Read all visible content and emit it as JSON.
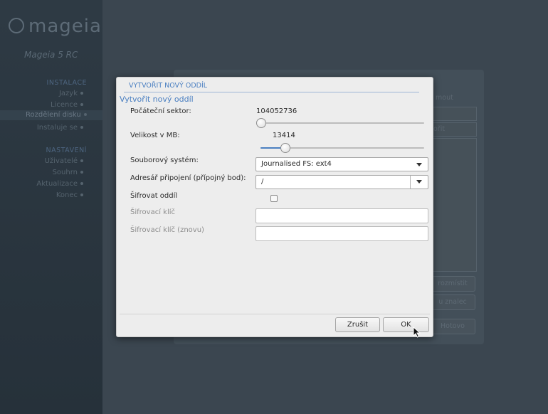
{
  "sidebar": {
    "logo_text": "mageia",
    "version": "Mageia 5 RC",
    "sections": [
      {
        "heading": "INSTALACE",
        "items": [
          {
            "label": "Jazyk",
            "active": false
          },
          {
            "label": "Licence",
            "active": false
          },
          {
            "label": "Rozdělení disku",
            "active": true
          },
          {
            "label": "Instaluje se",
            "active": false
          }
        ]
      },
      {
        "heading": "NASTAVENÍ",
        "items": [
          {
            "label": "Uživatelé",
            "active": false
          },
          {
            "label": "Souhrn",
            "active": false
          },
          {
            "label": "Aktualizace",
            "active": false
          },
          {
            "label": "Konec",
            "active": false
          }
        ]
      }
    ]
  },
  "background_panel": {
    "partial_labels": [
      "mout",
      "ořit"
    ],
    "buttons": [
      "rozmístit",
      "u znalec",
      "Hotovo"
    ]
  },
  "dialog": {
    "title": "VYTVOŘIT NOVÝ ODDÍL",
    "subtitle": "Vytvořit nový oddíl",
    "start_sector": {
      "label": "Počáteční sektor:",
      "value": "104052736",
      "slider_fraction": 0.0
    },
    "size": {
      "label": "Velikost v MB:",
      "value": "13414",
      "slider_fraction": 0.13
    },
    "filesystem": {
      "label": "Souborový systém:",
      "selected": "Journalised FS: ext4"
    },
    "mount_point": {
      "label": "Adresář připojení (přípojný bod):",
      "value": "/"
    },
    "encrypt": {
      "label": "Šifrovat oddíl",
      "checked": false
    },
    "encrypt_key": {
      "label": "Šifrovací klíč",
      "value": ""
    },
    "encrypt_key_again": {
      "label": "Šifrovací klíč (znovu)",
      "value": ""
    },
    "buttons": {
      "cancel": "Zrušit",
      "ok": "OK"
    }
  },
  "colors": {
    "accent": "#4a7fc1",
    "sidebar_bg": "#2e3a44",
    "overlay_bg": "#3b4650",
    "dialog_bg": "#ededed"
  }
}
